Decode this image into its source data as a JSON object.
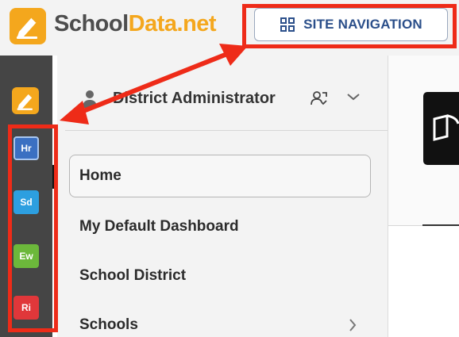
{
  "header": {
    "logo_text_part1": "School",
    "logo_text_part2": "Data.net",
    "site_nav_label": "SITE NAVIGATION"
  },
  "sidebar": {
    "apps": [
      {
        "label": "Hr",
        "color": "#3b70c2"
      },
      {
        "label": "Sd",
        "color": "#2d9fe0"
      },
      {
        "label": "Ew",
        "color": "#6cb83b"
      },
      {
        "label": "Ri",
        "color": "#e0373a"
      }
    ]
  },
  "nav_panel": {
    "user_name": "District Administrator",
    "menu": [
      {
        "label": "Home",
        "active": true
      },
      {
        "label": "My Default Dashboard"
      },
      {
        "label": "School District"
      },
      {
        "label": "Schools",
        "has_children": true
      }
    ]
  },
  "icons": {
    "logo": "schooldata-logo-icon",
    "site_nav": "grid-icon",
    "user": "user-icon",
    "swap": "switch-user-icon",
    "chevron_down": "chevron-down-icon",
    "chevron_right": "chevron-right-icon",
    "content": "book-icon"
  },
  "colors": {
    "brand_orange": "#f4a71d",
    "brand_gray": "#4d4d4d",
    "nav_blue": "#2b4f8a",
    "annotation_red": "#ee2b18"
  }
}
